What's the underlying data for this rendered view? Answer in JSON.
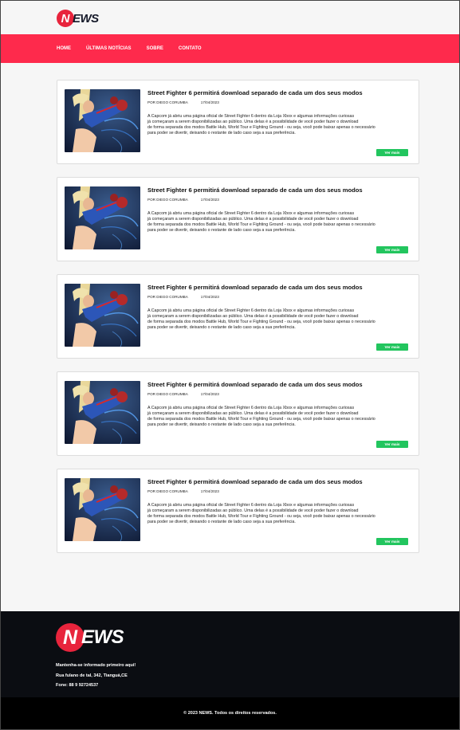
{
  "brand": {
    "letter": "N",
    "rest": "EWS",
    "primary": "#fe2a4c",
    "dark": "#161a2a"
  },
  "nav": {
    "items": [
      "HOME",
      "ÚLTIMAS NOTÍCIAS",
      "SOBRE",
      "CONTATO"
    ]
  },
  "posts": [
    {
      "title": "Street Fighter 6 permitirá download separado de cada um dos seus modos",
      "author": "POR DIEGO CORUMBA",
      "date": "17/04/2023",
      "lines": [
        "A Capcom já abriu uma página oficial de Street Fighter 6 dentro da Loja Xbox e algumas informações curiosas",
        "já começaram a serem disponibilizadas ao público. Uma delas é a possibilidade de você poder fazer o download",
        "de forma separada dos modos Battle Hub, World Tour e Fighting Ground - ou seja, você pode baixar apenas o necessário",
        "para poder se divertir, deixando o restante de lado caso seja a sua preferência."
      ],
      "button": "Ver mais"
    },
    {
      "title": "Street Fighter 6 permitirá download separado de cada um dos seus modos",
      "author": "POR DIEGO CORUMBA",
      "date": "17/04/2023",
      "lines": [
        "A Capcom já abriu uma página oficial de Street Fighter 6 dentro da Loja Xbox e algumas informações curiosas",
        "já começaram a serem disponibilizadas ao público. Uma delas é a possibilidade de você poder fazer o download",
        "de forma separada dos modos Battle Hub, World Tour e Fighting Ground - ou seja, você pode baixar apenas o necessário",
        "para poder se divertir, deixando o restante de lado caso seja a sua preferência."
      ],
      "button": "Ver mais"
    },
    {
      "title": "Street Fighter 6 permitirá download separado de cada um dos seus modos",
      "author": "POR DIEGO CORUMBA",
      "date": "17/04/2023",
      "lines": [
        "A Capcom já abriu uma página oficial de Street Fighter 6 dentro da Loja Xbox e algumas informações curiosas",
        "já começaram a serem disponibilizadas ao público. Uma delas é a possibilidade de você poder fazer o download",
        "de forma separada dos modos Battle Hub, World Tour e Fighting Ground - ou seja, você pode baixar apenas o necessário",
        "para poder se divertir, deixando o restante de lado caso seja a sua preferência."
      ],
      "button": "Ver mais"
    },
    {
      "title": "Street Fighter 6 permitirá download separado de cada um dos seus modos",
      "author": "POR DIEGO CORUMBA",
      "date": "17/04/2023",
      "lines": [
        "A Capcom já abriu uma página oficial de Street Fighter 6 dentro da Loja Xbox e algumas informações curiosas",
        "já começaram a serem disponibilizadas ao público. Uma delas é a possibilidade de você poder fazer o download",
        "de forma separada dos modos Battle Hub, World Tour e Fighting Ground - ou seja, você pode baixar apenas o necessário",
        "para poder se divertir, deixando o restante de lado caso seja a sua preferência."
      ],
      "button": "Ver mais"
    },
    {
      "title": "Street Fighter 6 permitirá download separado de cada um dos seus modos",
      "author": "POR DIEGO CORUMBA",
      "date": "17/04/2023",
      "lines": [
        "A Capcom já abriu uma página oficial de Street Fighter 6 dentro da Loja Xbox e algumas informações curiosas",
        "já começaram a serem disponibilizadas ao público. Uma delas é a possibilidade de você poder fazer o download",
        "de forma separada dos modos Battle Hub, World Tour e Fighting Ground - ou seja, você pode baixar apenas o necessário",
        "para poder se divertir, deixando o restante de lado caso seja a sua preferência."
      ],
      "button": "Ver mais"
    }
  ],
  "footer": {
    "tagline": "Mantenha-se informado primeiro aqui!",
    "address": "Rua fulano de tal, 342,  Tianguá,CE",
    "phone": "Fone: 88 9 92724537",
    "copyright": "© 2023 NEWS. Todos os direitos reservados."
  }
}
